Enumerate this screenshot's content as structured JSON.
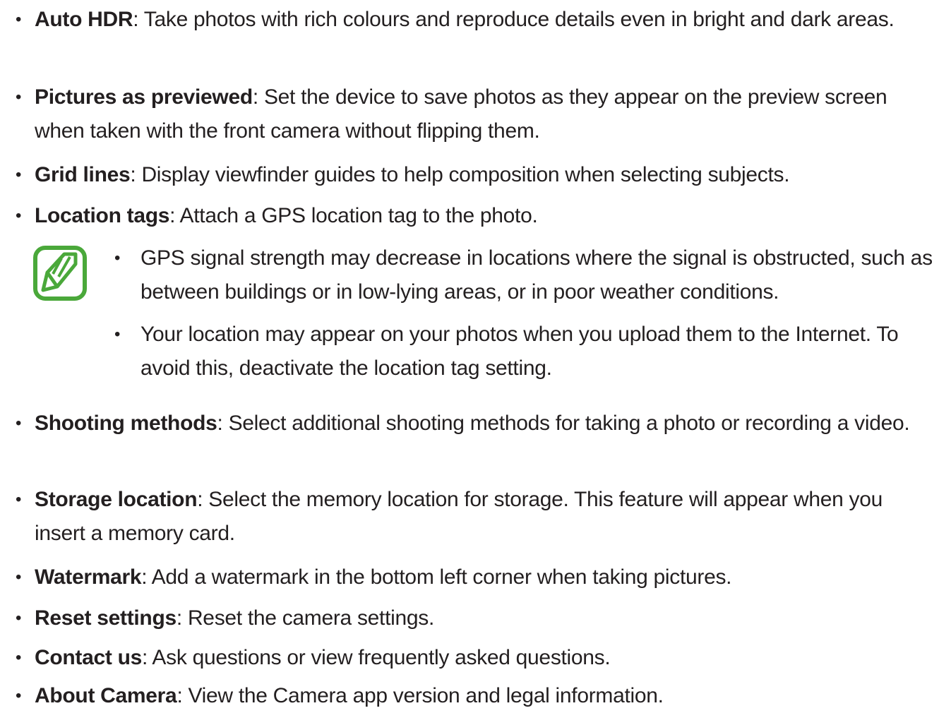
{
  "items": [
    {
      "term": "Auto HDR",
      "desc": ": Take photos with rich colours and reproduce details even in bright and dark areas."
    },
    {
      "term": "Pictures as previewed",
      "desc": ": Set the device to save photos as they appear on the preview screen when taken with the front camera without flipping them."
    },
    {
      "term": "Grid lines",
      "desc": ": Display viewfinder guides to help composition when selecting subjects."
    },
    {
      "term": "Location tags",
      "desc": ": Attach a GPS location tag to the photo."
    },
    {
      "term": "Shooting methods",
      "desc": ": Select additional shooting methods for taking a photo or recording a video."
    },
    {
      "term": "Storage location",
      "desc": ": Select the memory location for storage. This feature will appear when you insert a memory card."
    },
    {
      "term": "Watermark",
      "desc": ": Add a watermark in the bottom left corner when taking pictures."
    },
    {
      "term": "Reset settings",
      "desc": ": Reset the camera settings."
    },
    {
      "term": "Contact us",
      "desc": ": Ask questions or view frequently asked questions."
    },
    {
      "term": "About Camera",
      "desc": ": View the Camera app version and legal information."
    }
  ],
  "note": {
    "icon": "note-pencil-icon",
    "icon_color": "#4aa83a",
    "bullets": [
      "GPS signal strength may decrease in locations where the signal is obstructed, such as between buildings or in low-lying areas, or in poor weather conditions.",
      "Your location may appear on your photos when you upload them to the Internet. To avoid this, deactivate the location tag setting."
    ]
  },
  "bullet_char": "•"
}
